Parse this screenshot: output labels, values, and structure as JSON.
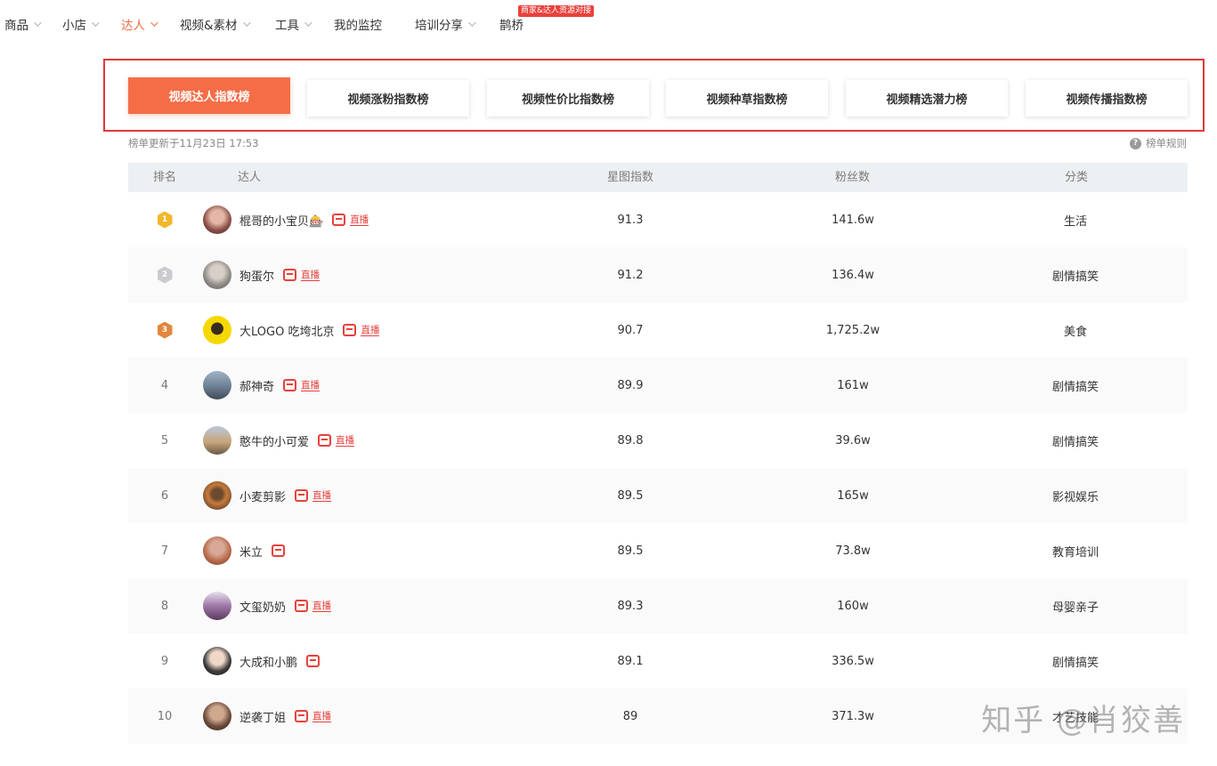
{
  "nav": {
    "items": [
      {
        "label": "商品",
        "chevron": true
      },
      {
        "label": "小店",
        "chevron": true
      },
      {
        "label": "达人",
        "chevron": true,
        "active": true
      },
      {
        "label": "视频&素材",
        "chevron": true
      },
      {
        "label": "工具",
        "chevron": true
      },
      {
        "label": "我的监控",
        "chevron": false
      },
      {
        "label": "培训分享",
        "chevron": true
      },
      {
        "label": "鹊桥",
        "chevron": false
      }
    ],
    "badge": "商家&达人资源对接"
  },
  "tabs": [
    {
      "label": "视频达人指数榜",
      "active": true
    },
    {
      "label": "视频涨粉指数榜"
    },
    {
      "label": "视频性价比指数榜"
    },
    {
      "label": "视频种草指数榜"
    },
    {
      "label": "视频精选潜力榜"
    },
    {
      "label": "视频传播指数榜"
    }
  ],
  "meta": {
    "update_time": "榜单更新于11月23日 17:53",
    "rules_label": "榜单规则",
    "rules_icon": "?"
  },
  "table": {
    "headers": {
      "rank": "排名",
      "kol": "达人",
      "score": "星图指数",
      "fans": "粉丝数",
      "category": "分类"
    },
    "rows": [
      {
        "rank": "1",
        "medal": "gold",
        "name": "棍哥的小宝贝🎰",
        "live": true,
        "score": "91.3",
        "fans": "141.6w",
        "category": "生活"
      },
      {
        "rank": "2",
        "medal": "silver",
        "name": "狗蛋尔",
        "live": true,
        "score": "91.2",
        "fans": "136.4w",
        "category": "剧情搞笑"
      },
      {
        "rank": "3",
        "medal": "bronze",
        "name": "大LOGO 吃垮北京",
        "live": true,
        "score": "90.7",
        "fans": "1,725.2w",
        "category": "美食"
      },
      {
        "rank": "4",
        "medal": "",
        "name": "郝神奇",
        "live": true,
        "score": "89.9",
        "fans": "161w",
        "category": "剧情搞笑"
      },
      {
        "rank": "5",
        "medal": "",
        "name": "憨牛的小可爱",
        "live": true,
        "score": "89.8",
        "fans": "39.6w",
        "category": "剧情搞笑"
      },
      {
        "rank": "6",
        "medal": "",
        "name": "小麦剪影",
        "live": true,
        "score": "89.5",
        "fans": "165w",
        "category": "影视娱乐"
      },
      {
        "rank": "7",
        "medal": "",
        "name": "米立",
        "live": false,
        "score": "89.5",
        "fans": "73.8w",
        "category": "教育培训"
      },
      {
        "rank": "8",
        "medal": "",
        "name": "文玺奶奶",
        "live": true,
        "score": "89.3",
        "fans": "160w",
        "category": "母婴亲子"
      },
      {
        "rank": "9",
        "medal": "",
        "name": "大成和小鹏",
        "live": false,
        "score": "89.1",
        "fans": "336.5w",
        "category": "剧情搞笑"
      },
      {
        "rank": "10",
        "medal": "",
        "name": "逆袭丁姐",
        "live": true,
        "score": "89",
        "fans": "371.3w",
        "category": "才艺技能"
      }
    ],
    "live_label": "直播"
  },
  "watermark": "知乎 @肖狡善",
  "colors": {
    "accent": "#f46d47",
    "highlight_frame": "#e0393a",
    "tag_red": "#e8413c",
    "header_bg": "#ecf0f3",
    "gold": "#f2b72c",
    "silver": "#c9cbcf",
    "bronze": "#e2873c"
  }
}
